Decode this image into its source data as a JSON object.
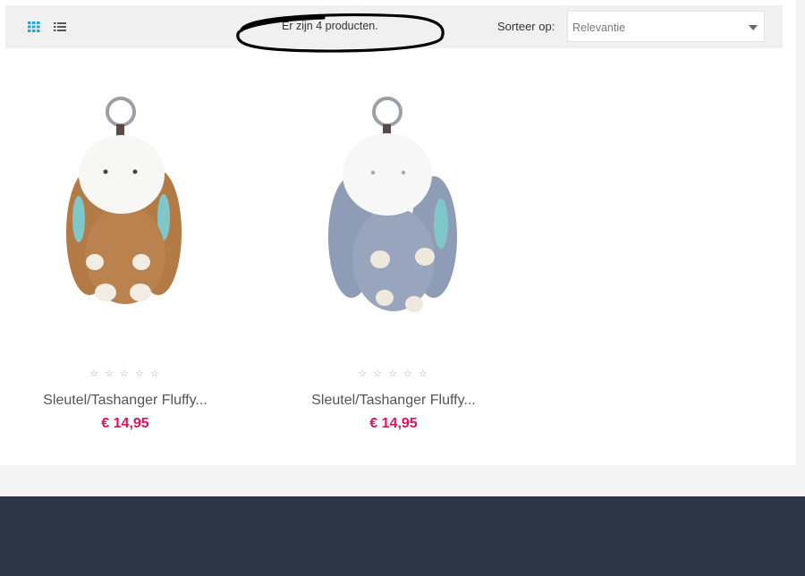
{
  "toolbar": {
    "product_count": "Er zijn 4 producten.",
    "sort_label": "Sorteer op:",
    "sort_value": "Relevantie",
    "grid_view_icon": "grid-view-icon",
    "list_view_icon": "list-view-icon",
    "accent_color": "#21a8d0"
  },
  "products": [
    {
      "name": "Sleutel/Tashanger Fluffy...",
      "price": "€ 14,95",
      "stars": "☆ ☆ ☆ ☆ ☆",
      "fur_color": "#b37a45",
      "rating": 0
    },
    {
      "name": "Sleutel/Tashanger Fluffy...",
      "price": "€ 14,95",
      "stars": "☆ ☆ ☆ ☆ ☆",
      "fur_color": "#8e9cb5",
      "rating": 0
    }
  ],
  "colors": {
    "price": "#e0115f",
    "footer": "#2b3744"
  }
}
